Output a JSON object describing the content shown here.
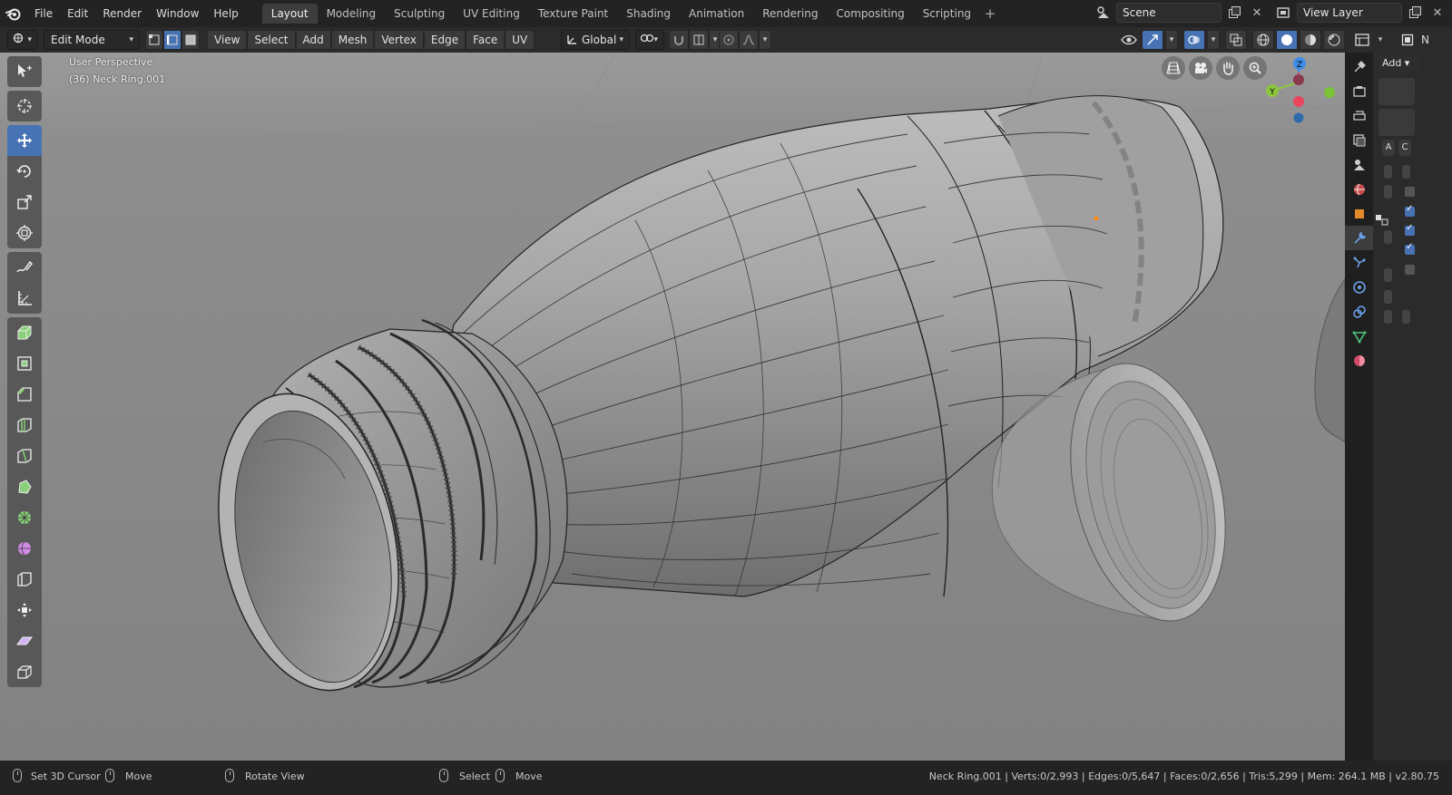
{
  "menu": {
    "items": [
      "File",
      "Edit",
      "Render",
      "Window",
      "Help"
    ]
  },
  "workspaces": {
    "tabs": [
      "Layout",
      "Modeling",
      "Sculpting",
      "UV Editing",
      "Texture Paint",
      "Shading",
      "Animation",
      "Rendering",
      "Compositing",
      "Scripting"
    ],
    "active": "Layout"
  },
  "scene": {
    "name": "Scene",
    "view_layer": "View Layer"
  },
  "header": {
    "mode": "Edit Mode",
    "menus": [
      "View",
      "Select",
      "Add",
      "Mesh",
      "Vertex",
      "Edge",
      "Face",
      "UV"
    ],
    "orientation": "Global"
  },
  "overlay": {
    "perspective": "User Perspective",
    "object_info": "(36) Neck Ring.001"
  },
  "gizmo": {
    "z": "Z",
    "y": "Y"
  },
  "properties": {
    "add_label": "Add",
    "a_label": "A",
    "c_label": "C",
    "n_label": "N"
  },
  "status": {
    "left_hint": "Set 3D Cursor",
    "move_hint": "Move",
    "rotate_hint": "Rotate View",
    "select_hint": "Select",
    "move_hint2": "Move",
    "stats": "Neck Ring.001 | Verts:0/2,993 | Edges:0/5,647 | Faces:0/2,656 | Tris:5,299 | Mem: 264.1 MB | v2.80.75"
  },
  "colors": {
    "accent": "#4772b3",
    "viewport_bg": "#8c8c8c",
    "x_axis": "#e8475f",
    "y_axis": "#8cc63f",
    "z_axis": "#3f8ee8"
  }
}
